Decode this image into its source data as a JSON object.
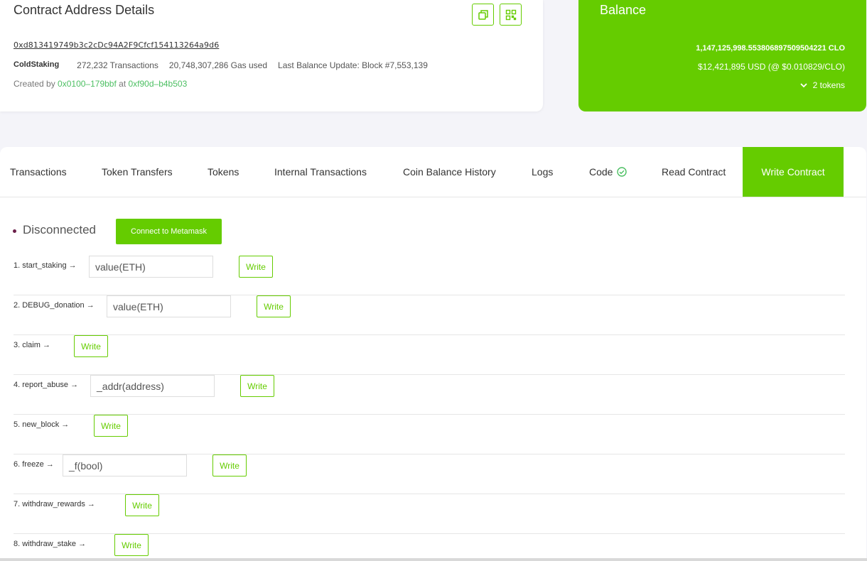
{
  "details": {
    "title": "Contract Address Details",
    "address": "0xd813419749b3c2cDc94A2F9Cfcf154113264a9d6",
    "contract_name": "ColdStaking",
    "transactions": "272,232 Transactions",
    "gas_used": "20,748,307,286 Gas used",
    "last_balance_update": "Last Balance Update: Block #7,553,139",
    "created_by_prefix": "Created by",
    "creator": "0x0100–179bbf",
    "at_text": "at",
    "creation_tx": "0xf90d–b4b503",
    "icons": [
      "copy-icon",
      "qr-code-icon"
    ]
  },
  "balance": {
    "title": "Balance",
    "clo": "1,147,125,998.553806897509504221 CLO",
    "usd": "$12,421,895 USD (@ $0.010829/CLO)",
    "tokens": "2 tokens"
  },
  "tabs": [
    {
      "label": "Transactions"
    },
    {
      "label": "Token Transfers"
    },
    {
      "label": "Tokens"
    },
    {
      "label": "Internal Transactions"
    },
    {
      "label": "Coin Balance History"
    },
    {
      "label": "Logs"
    },
    {
      "label": "Code"
    },
    {
      "label": "Read Contract"
    },
    {
      "label": "Write Contract"
    }
  ],
  "write": {
    "status": "Disconnected",
    "connect_label": "Connect to Metamask",
    "write_label": "Write",
    "functions": [
      {
        "label": "1. start_staking →",
        "placeholder": "value(ETH)"
      },
      {
        "label": "2. DEBUG_donation →",
        "placeholder": "value(ETH)"
      },
      {
        "label": "3. claim →",
        "placeholder": ""
      },
      {
        "label": "4. report_abuse →",
        "placeholder": "_addr(address)"
      },
      {
        "label": "5. new_block →",
        "placeholder": ""
      },
      {
        "label": "6. freeze →",
        "placeholder": "_f(bool)"
      },
      {
        "label": "7. withdraw_rewards →",
        "placeholder": ""
      },
      {
        "label": "8. withdraw_stake →",
        "placeholder": ""
      }
    ]
  },
  "colors": {
    "accent": "#65cc00",
    "link": "#4cbf62",
    "status_dot": "#6b1f4a"
  }
}
